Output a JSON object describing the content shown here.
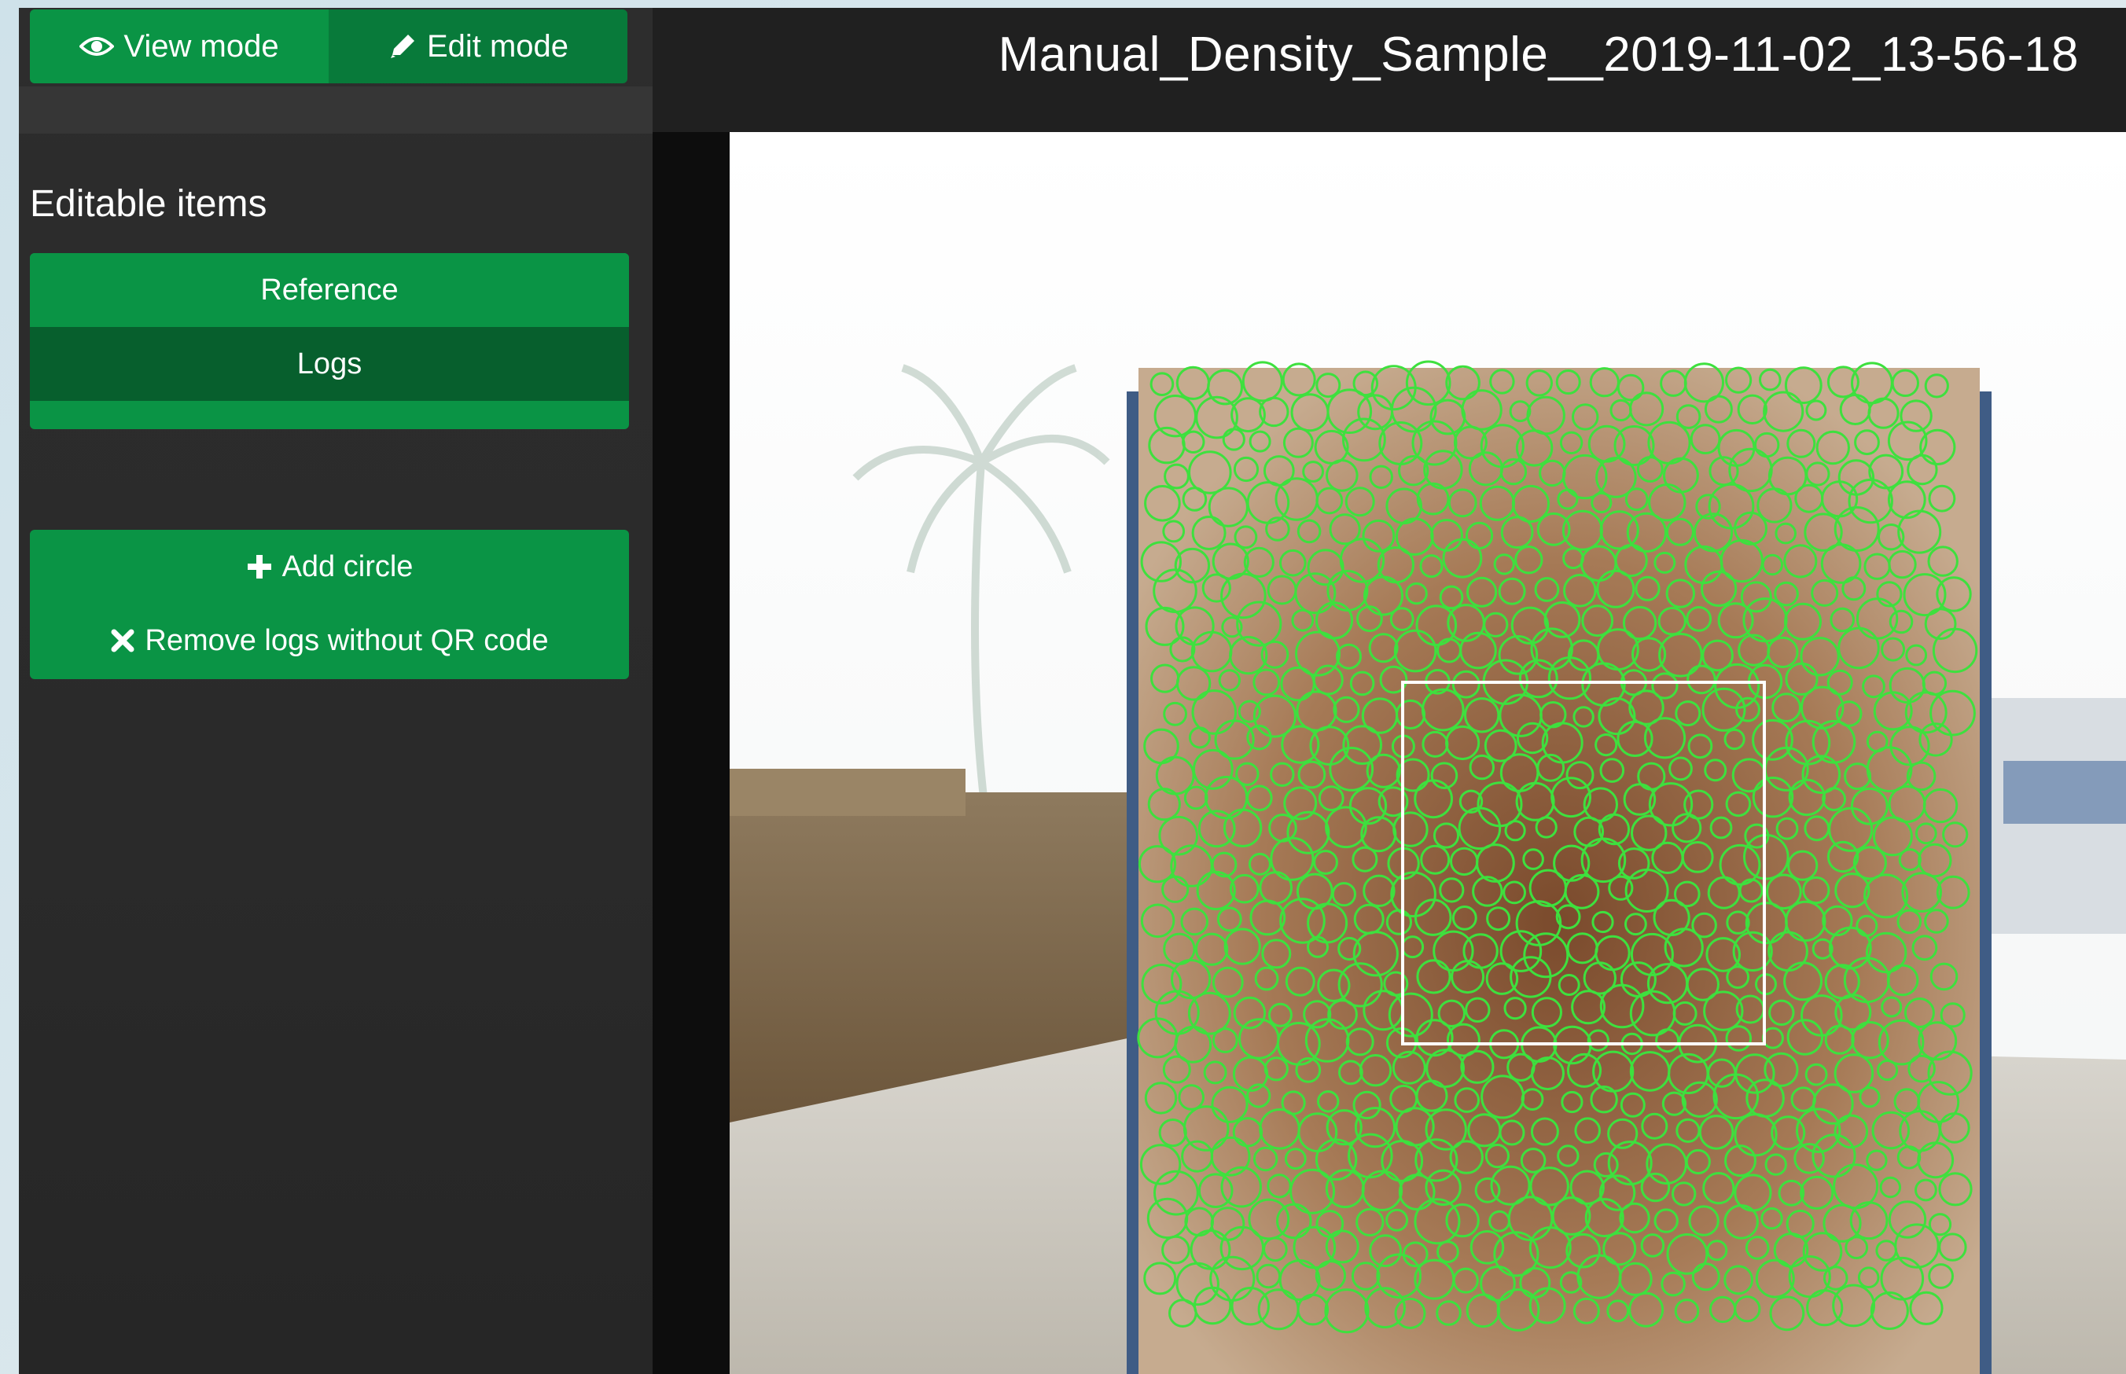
{
  "mode": {
    "view_label": "View mode",
    "edit_label": "Edit mode",
    "active": "edit"
  },
  "sidebar": {
    "section_title": "Editable items",
    "items": [
      {
        "label": "Reference"
      },
      {
        "label": "Logs"
      }
    ],
    "active_item": "Logs",
    "actions": [
      {
        "label": "Add circle",
        "icon": "plus-icon"
      },
      {
        "label": "Remove logs without QR code",
        "icon": "times-icon"
      }
    ]
  },
  "header": {
    "file_title": "Manual_Density_Sample__2019-11-02_13-56-18"
  },
  "colors": {
    "accent": "#0a9445",
    "accent_dark": "#075f2d",
    "circle": "#3ee03e",
    "selection": "#ffffff"
  }
}
